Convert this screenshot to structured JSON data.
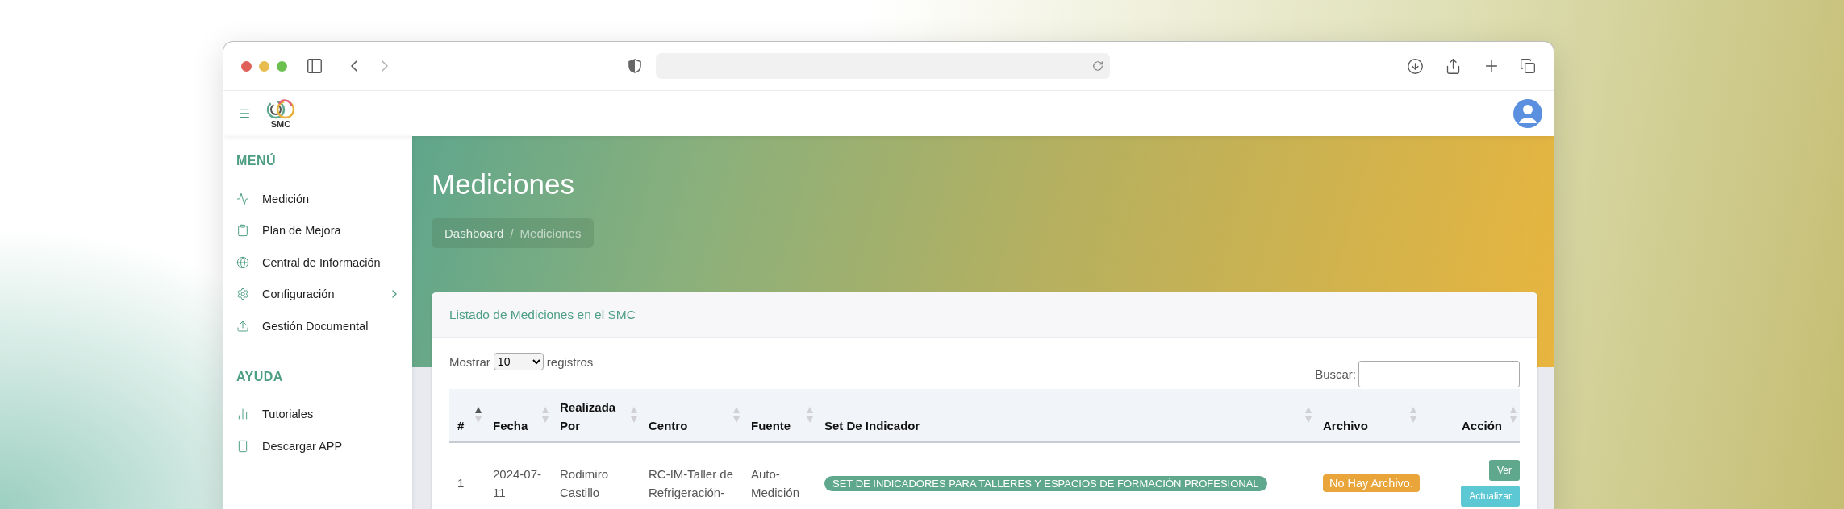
{
  "browser": {
    "back_enabled": true,
    "forward_enabled": false
  },
  "app_header": {
    "logo_text": "SMC"
  },
  "sidebar": {
    "sections": [
      {
        "title": "MENÚ",
        "items": [
          {
            "label": "Medición",
            "kind": "link"
          },
          {
            "label": "Plan de Mejora",
            "kind": "link"
          },
          {
            "label": "Central de Información",
            "kind": "link"
          },
          {
            "label": "Configuración",
            "kind": "submenu"
          },
          {
            "label": "Gestión Documental",
            "kind": "link"
          }
        ]
      },
      {
        "title": "AYUDA",
        "items": [
          {
            "label": "Tutoriales",
            "kind": "link"
          },
          {
            "label": "Descargar APP",
            "kind": "link"
          }
        ]
      }
    ]
  },
  "page": {
    "title": "Mediciones",
    "breadcrumb_separator": "/",
    "breadcrumb": [
      {
        "label": "Dashboard",
        "current": false
      },
      {
        "label": "Mediciones",
        "current": true
      }
    ]
  },
  "card": {
    "title": "Listado de Mediciones en el SMC",
    "length": {
      "before": "Mostrar",
      "value": "10",
      "after": "registros"
    },
    "search": {
      "label": "Buscar:"
    },
    "table": {
      "columns": [
        {
          "label": "#",
          "sorted": true
        },
        {
          "label": "Fecha",
          "sorted": false
        },
        {
          "label": "Realizada Por",
          "sorted": false
        },
        {
          "label": "Centro",
          "sorted": false
        },
        {
          "label": "Fuente",
          "sorted": false
        },
        {
          "label": "Set De Indicador",
          "sorted": false
        },
        {
          "label": "Archivo",
          "sorted": false
        },
        {
          "label": "Acción",
          "sorted": false
        }
      ],
      "rows": [
        {
          "number": "1",
          "fecha": "2024-07-11",
          "realizada_por": "Rodimiro Castillo",
          "centro": "RC-IM-Taller de Refrigeración-",
          "fuente": "Auto-Medición",
          "set": "SET DE INDICADORES PARA TALLERES Y ESPACIOS DE FORMACIÓN PROFESIONAL",
          "archivo": "No Hay Archivo.",
          "actions": [
            {
              "label": "Ver",
              "kind": "view"
            },
            {
              "label": "Actualizar",
              "kind": "update"
            }
          ]
        }
      ]
    }
  }
}
